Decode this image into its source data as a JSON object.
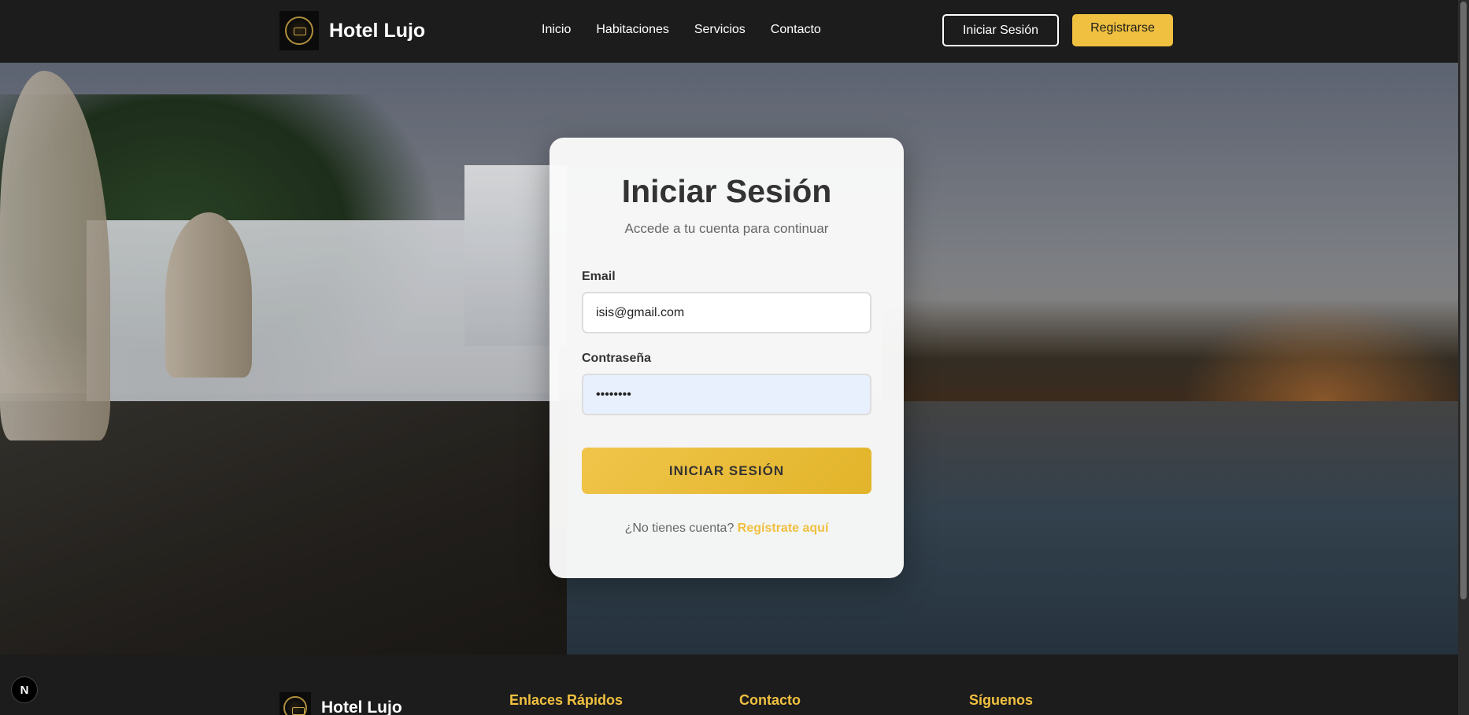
{
  "header": {
    "brand_name": "Hotel Lujo",
    "nav": [
      "Inicio",
      "Habitaciones",
      "Servicios",
      "Contacto"
    ],
    "login_label": "Iniciar Sesión",
    "register_label": "Registrarse"
  },
  "login_card": {
    "title": "Iniciar Sesión",
    "subtitle": "Accede a tu cuenta para continuar",
    "email_label": "Email",
    "email_value": "isis@gmail.com",
    "password_label": "Contraseña",
    "password_value": "••••••••",
    "submit_label": "INICIAR SESIÓN",
    "signup_prompt": "¿No tienes cuenta?",
    "signup_link": "Regístrate aquí"
  },
  "footer": {
    "brand_name": "Hotel Lujo",
    "headings": [
      "Enlaces Rápidos",
      "Contacto",
      "Síguenos"
    ]
  },
  "dev_badge": "N",
  "colors": {
    "accent": "#f0c040",
    "header_bg": "#1c1c1c",
    "card_bg": "#fafafa"
  }
}
